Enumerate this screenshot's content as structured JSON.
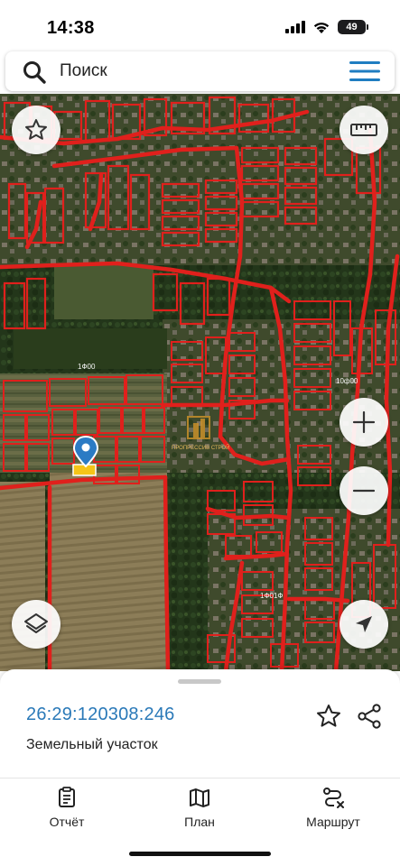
{
  "status_bar": {
    "time": "14:38",
    "battery": "49"
  },
  "search": {
    "label": "Поиск",
    "icon": "search-icon",
    "menu_icon": "hamburger-menu-icon"
  },
  "map": {
    "road_labels": [
      "1Ф00",
      "10ф00",
      "1Ф01Ф"
    ],
    "watermark": "ПРОПРЕССИВ СТРОЙ",
    "marker_icon": "location-pin-icon",
    "controls": [
      "favorite-star-icon",
      "ruler-icon",
      "zoom-in-icon",
      "zoom-out-icon",
      "layers-icon",
      "navigation-arrow-icon"
    ],
    "colors": {
      "parcel_border": "#e0201c",
      "selected_parcel": "#f5c518",
      "marker": "#2b7bc4"
    }
  },
  "parcel": {
    "cadastral_number": "26:29:120308:246",
    "type": "Земельный участок"
  },
  "nav": {
    "items": [
      {
        "label": "Отчёт",
        "icon": "report-icon"
      },
      {
        "label": "План",
        "icon": "map-plan-icon"
      },
      {
        "label": "Маршрут",
        "icon": "route-icon"
      }
    ]
  }
}
